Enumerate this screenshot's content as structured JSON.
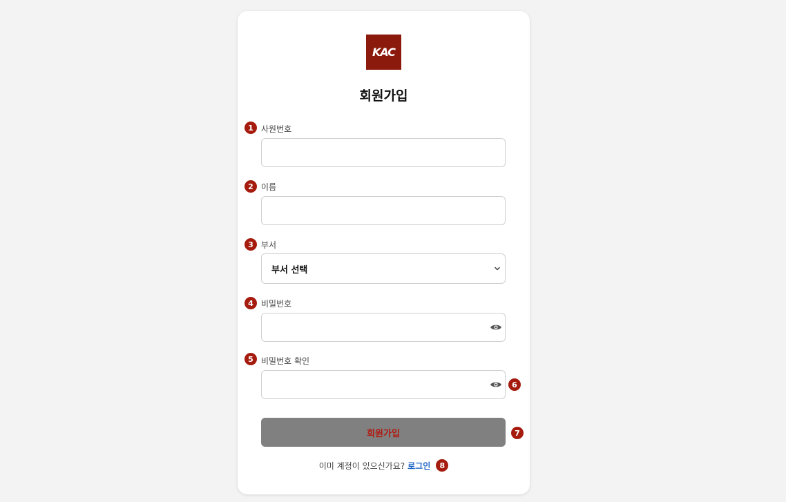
{
  "logo": {
    "text": "KAC"
  },
  "title": "회원가입",
  "fields": [
    {
      "badge": "1",
      "label": "사원번호",
      "value": ""
    },
    {
      "badge": "2",
      "label": "이름",
      "value": ""
    },
    {
      "badge": "3",
      "label": "부서",
      "selected": "부서 선택"
    },
    {
      "badge": "4",
      "label": "비밀번호",
      "value": "",
      "icon": "eye-icon"
    },
    {
      "badge": "5",
      "label": "비밀번호 확인",
      "value": "",
      "icon": "eye-icon"
    }
  ],
  "eye_badge": "6",
  "submit": {
    "label": "회원가입",
    "badge": "7"
  },
  "footer": {
    "prompt": "이미 계정이 있으신가요?",
    "link": "로그인",
    "badge": "8"
  },
  "colors": {
    "background": "#f3f3f3",
    "badge": "#a51c0e",
    "logo": "#8b1a0c",
    "submit_bg": "#808080",
    "submit_text": "#b01a10",
    "link": "#1a64c4"
  }
}
